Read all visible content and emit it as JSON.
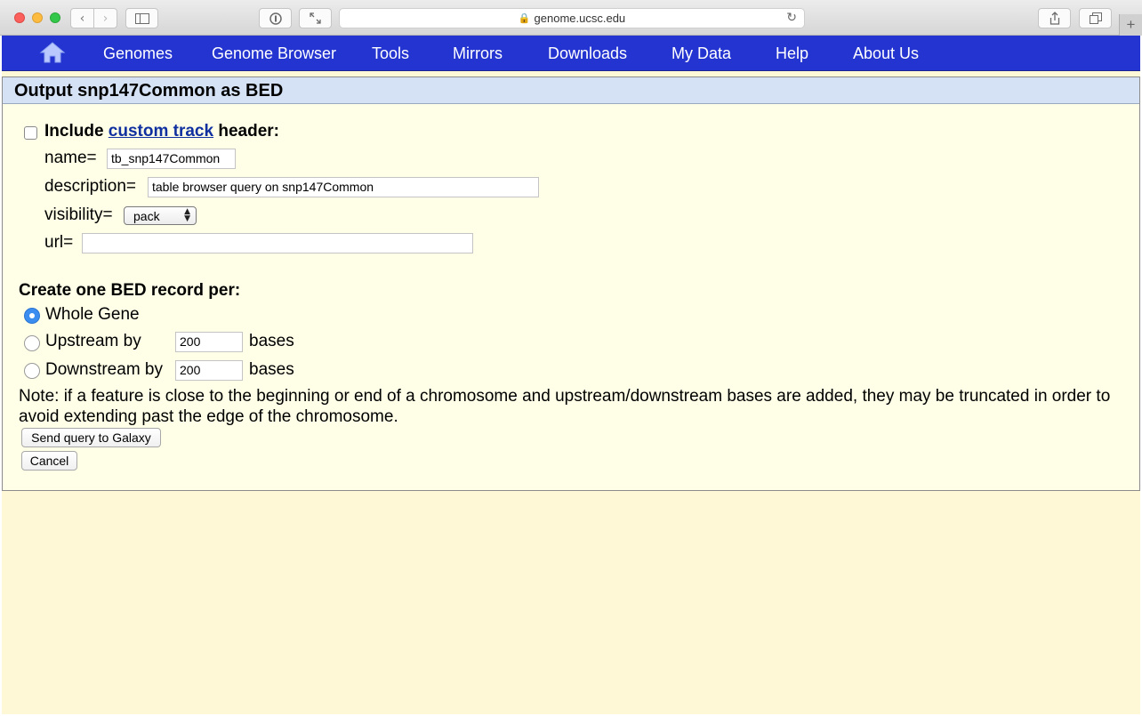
{
  "browser": {
    "url": "genome.ucsc.edu"
  },
  "nav": {
    "items": [
      "Genomes",
      "Genome Browser",
      "Tools",
      "Mirrors",
      "Downloads",
      "My Data",
      "Help",
      "About Us"
    ]
  },
  "panel": {
    "title": "Output snp147Common as BED",
    "header_prefix": "Include",
    "header_link": "custom track",
    "header_suffix": "header:",
    "name_label": "name=",
    "name_value": "tb_snp147Common",
    "description_label": "description=",
    "description_value": "table browser query on snp147Common",
    "visibility_label": "visibility=",
    "visibility_value": "pack",
    "url_label": "url=",
    "url_value": "",
    "record_heading": "Create one BED record per:",
    "opt_whole": "Whole Gene",
    "opt_upstream": "Upstream by",
    "opt_downstream": "Downstream by",
    "upstream_value": "200",
    "downstream_value": "200",
    "bases_label": "bases",
    "note": "Note: if a feature is close to the beginning or end of a chromosome and upstream/downstream bases are added, they may be truncated in order to avoid extending past the edge of the chromosome.",
    "send_button": "Send query to Galaxy",
    "cancel_button": "Cancel"
  }
}
